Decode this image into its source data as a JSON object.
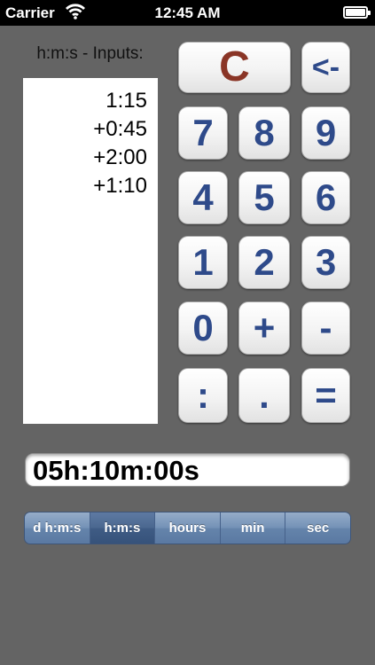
{
  "status_bar": {
    "carrier": "Carrier",
    "time": "12:45 AM"
  },
  "inputs": {
    "title": "h:m:s - Inputs:",
    "lines": [
      "1:15",
      "+0:45",
      "+2:00",
      "+1:10"
    ]
  },
  "keypad": {
    "clear": "C",
    "backspace": "<-",
    "k7": "7",
    "k8": "8",
    "k9": "9",
    "k4": "4",
    "k5": "5",
    "k6": "6",
    "k1": "1",
    "k2": "2",
    "k3": "3",
    "k0": "0",
    "plus": "+",
    "minus": "-",
    "colon": ":",
    "dot": ".",
    "equals": "="
  },
  "result": {
    "value": "05h:10m:00s"
  },
  "format_selector": {
    "options": [
      "d h:m:s",
      "h:m:s",
      "hours",
      "min",
      "sec"
    ],
    "selected": "h:m:s"
  },
  "colors": {
    "background": "#646464",
    "key_text": "#2e4a8a",
    "clear_text": "#8a3526",
    "segment": "#6584ab",
    "segment_selected": "#3f5c85"
  }
}
